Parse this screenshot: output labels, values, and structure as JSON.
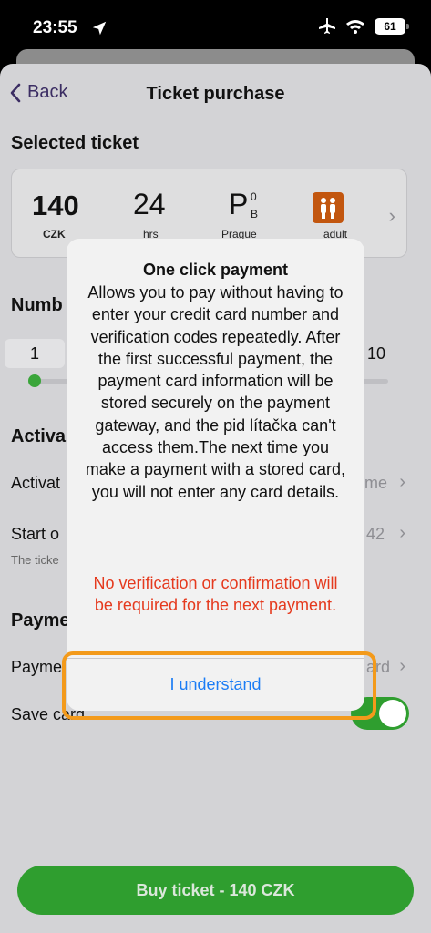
{
  "status_bar": {
    "time": "23:55",
    "battery": "61"
  },
  "nav": {
    "back_label": "Back",
    "title": "Ticket purchase"
  },
  "sections": {
    "selected_ticket": "Selected ticket",
    "number_partial": "Numb",
    "activation_partial": "Activa",
    "payment_partial": "Payme"
  },
  "ticket": {
    "price": "140",
    "currency": "CZK",
    "duration": "24",
    "duration_unit_partial": "hrs",
    "zone": "P",
    "zone_sup": "0",
    "zone_sub": "B",
    "zone_name_partial": "Prague",
    "category_partial": "adult"
  },
  "counter": {
    "value": "1",
    "max": "10",
    "slider_fraction": 0.0
  },
  "rows": {
    "activation_label_partial": "Activat",
    "activation_value_partial": "me",
    "start_label_partial": "Start o",
    "start_value_partial": "42",
    "start_note_partial": "The ticke",
    "payment_label_partial": "Payme",
    "payment_value_partial": "ard",
    "save_card_label": "Save card"
  },
  "toggle": {
    "save_card_on": true
  },
  "buy_button": "Buy ticket - 140 CZK",
  "alert": {
    "title": "One click payment",
    "body": "Allows you to pay without having to enter your credit card number and verification codes repeatedly. After the first successful payment, the payment card information will be stored securely on the payment gateway, and the pid lítačka can't access them.The next time you make a payment with a stored card, you will not enter any card details.",
    "warning": "No verification or confirmation will be required for the next payment.",
    "button": "I understand"
  },
  "colors": {
    "accent_green": "#2f9e2f",
    "link_blue": "#1a7cf5",
    "warning_red": "#e53a1e",
    "highlight_orange": "#f39a1b",
    "adult_badge": "#c2560f"
  },
  "icons": [
    "location-arrow-icon",
    "airplane-icon",
    "wifi-icon",
    "battery-icon",
    "chevron-left-icon",
    "chevron-right-icon",
    "adult-persons-icon"
  ]
}
